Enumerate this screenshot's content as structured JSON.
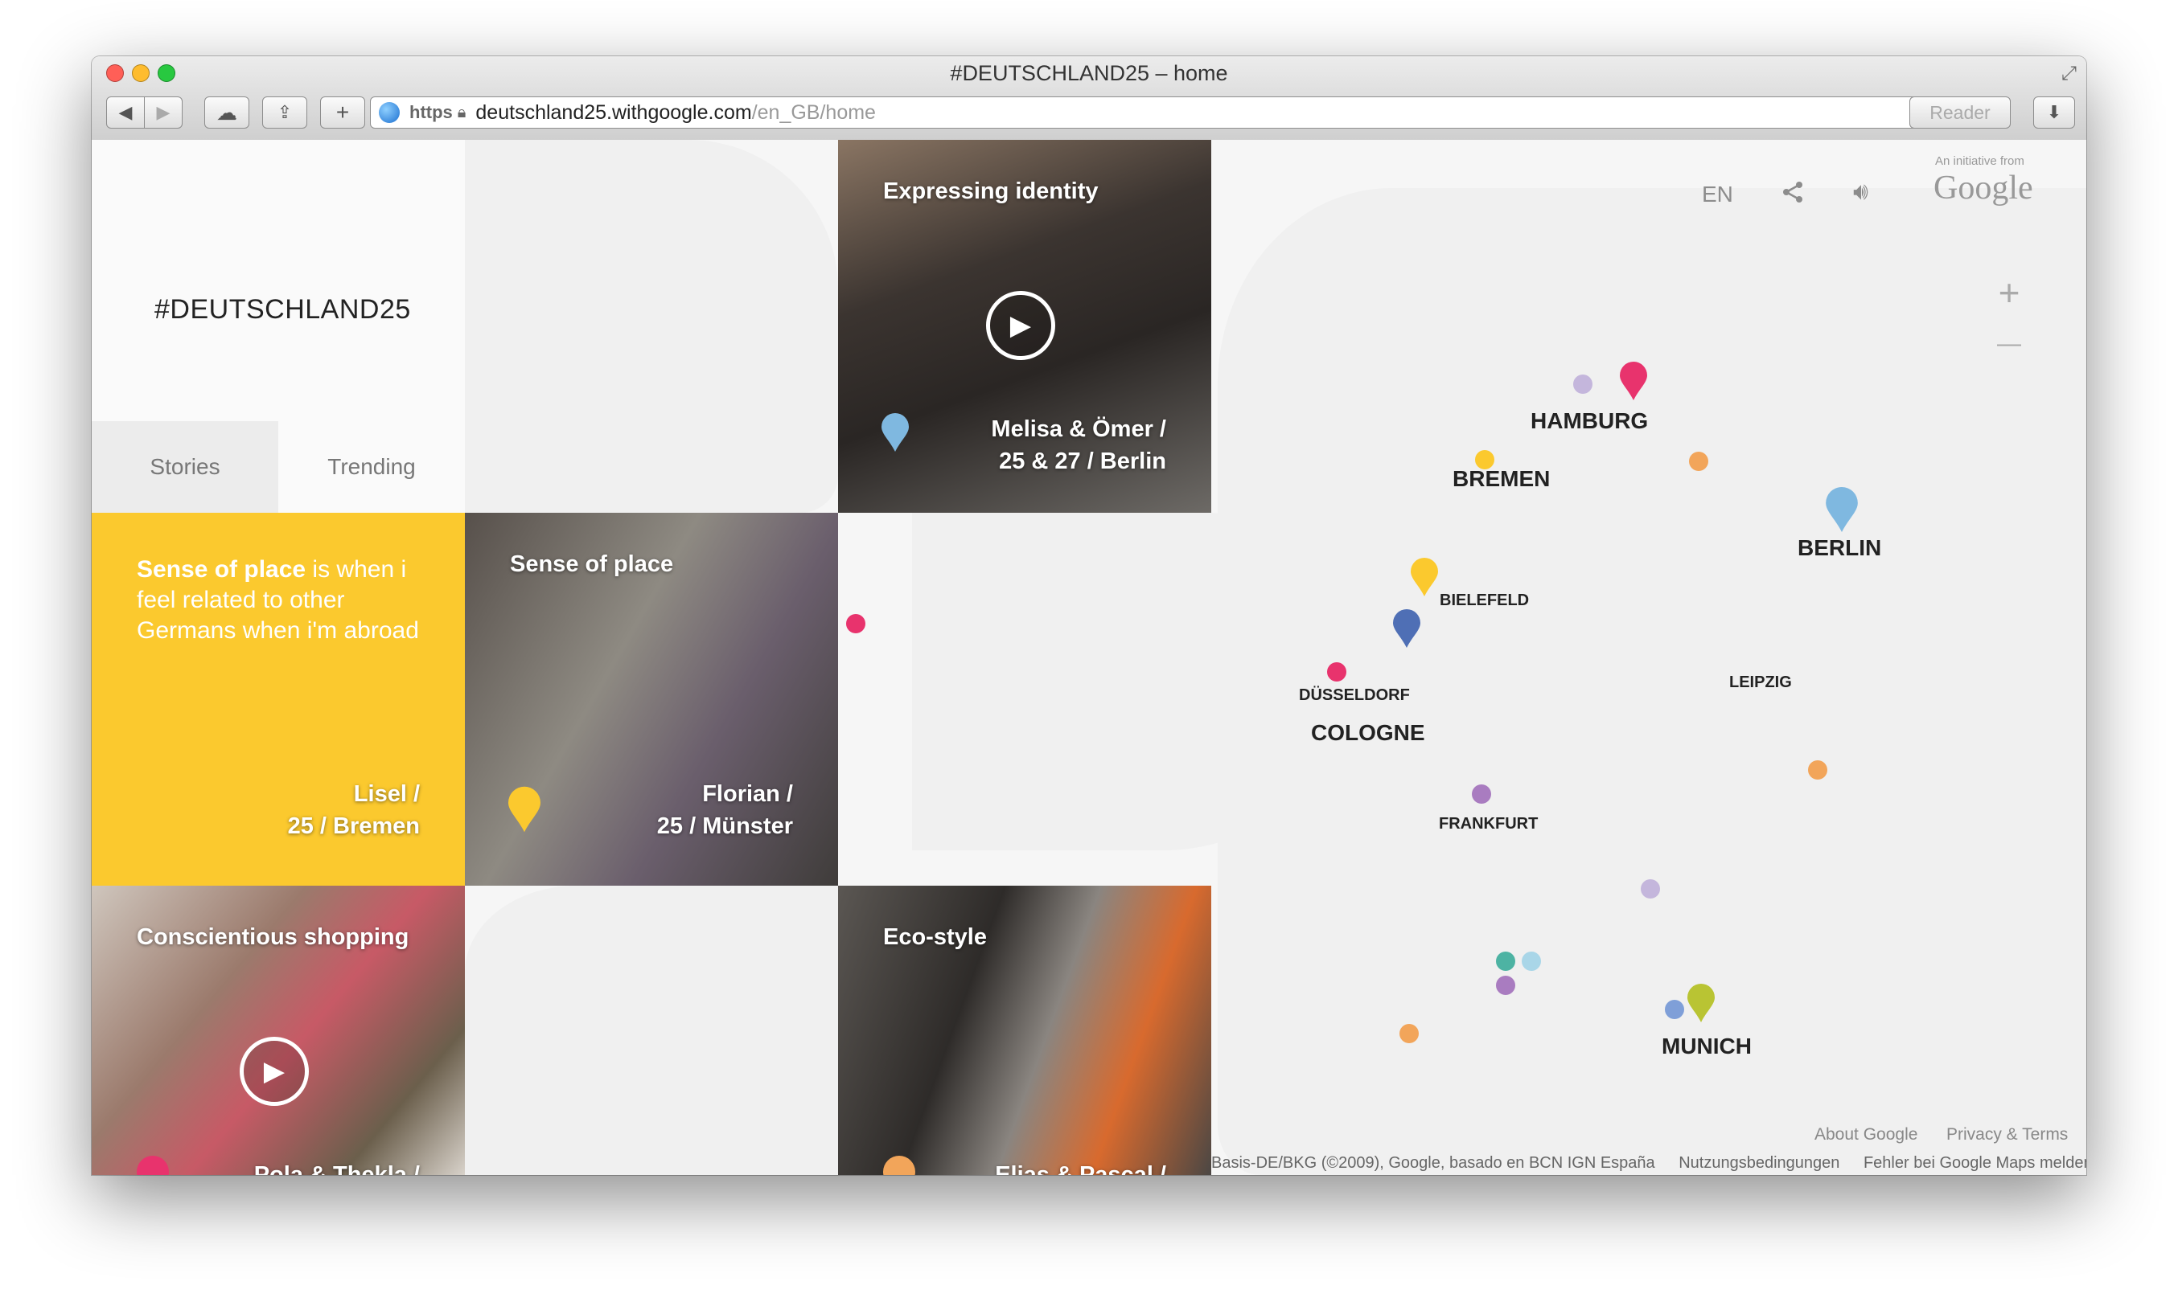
{
  "window": {
    "title": "#DEUTSCHLAND25 – home"
  },
  "toolbar": {
    "back": "◀",
    "forward": "▶",
    "cloud": "☁",
    "share": "⇪",
    "new_tab": "+",
    "reader": "Reader",
    "download": "⬇"
  },
  "url": {
    "scheme": "https",
    "host": "deutschland25.withgoogle.com",
    "path": "/en_GB/home"
  },
  "site": {
    "logo": "#DEUTSCHLAND25"
  },
  "tabs": [
    {
      "label": "Stories"
    },
    {
      "label": "Trending"
    }
  ],
  "tiles": {
    "expressing": {
      "title": "Expressing identity",
      "name_line1": "Melisa & Ömer /",
      "name_line2": "25 & 27 / Berlin"
    },
    "quote": {
      "highlight": "Sense of place",
      "rest": " is when i feel related to other Germans when i'm abroad",
      "name_line1": "Lisel /",
      "name_line2": "25 / Bremen"
    },
    "sense": {
      "title": "Sense of place",
      "name_line1": "Florian /",
      "name_line2": "25 / Münster"
    },
    "shopping": {
      "title": "Conscientious shopping",
      "name_line1": "Pola & Thekla /"
    },
    "eco": {
      "title": "Eco-style",
      "name_line1": "Elias & Pascal /"
    }
  },
  "map_controls": {
    "language": "EN",
    "initiative": "An initiative from",
    "google": "Google",
    "zoom_in": "+",
    "zoom_out": "—"
  },
  "cities": {
    "hamburg": "HAMBURG",
    "bremen": "BREMEN",
    "berlin": "BERLIN",
    "bielefeld": "BIELEFELD",
    "dusseldorf": "DÜSSELDORF",
    "cologne": "COLOGNE",
    "leipzig": "LEIPZIG",
    "frankfurt": "FRANKFURT",
    "munich": "MUNICH"
  },
  "footer": {
    "about": "About Google",
    "privacy": "Privacy & Terms",
    "attribution": "Basis-DE/BKG (©2009), Google, basado en BCN IGN España",
    "terms": "Nutzungsbedingungen",
    "report": "Fehler bei Google Maps melden"
  },
  "colors": {
    "yellow": "#fbc92e",
    "pink": "#e8336d",
    "blue": "#7fb8e0",
    "navy": "#4f6fb5",
    "orange": "#f2a55a",
    "purple": "#a97cc0",
    "teal": "#4db3a3",
    "lavender": "#c4b6dc",
    "olive": "#b9c433"
  }
}
